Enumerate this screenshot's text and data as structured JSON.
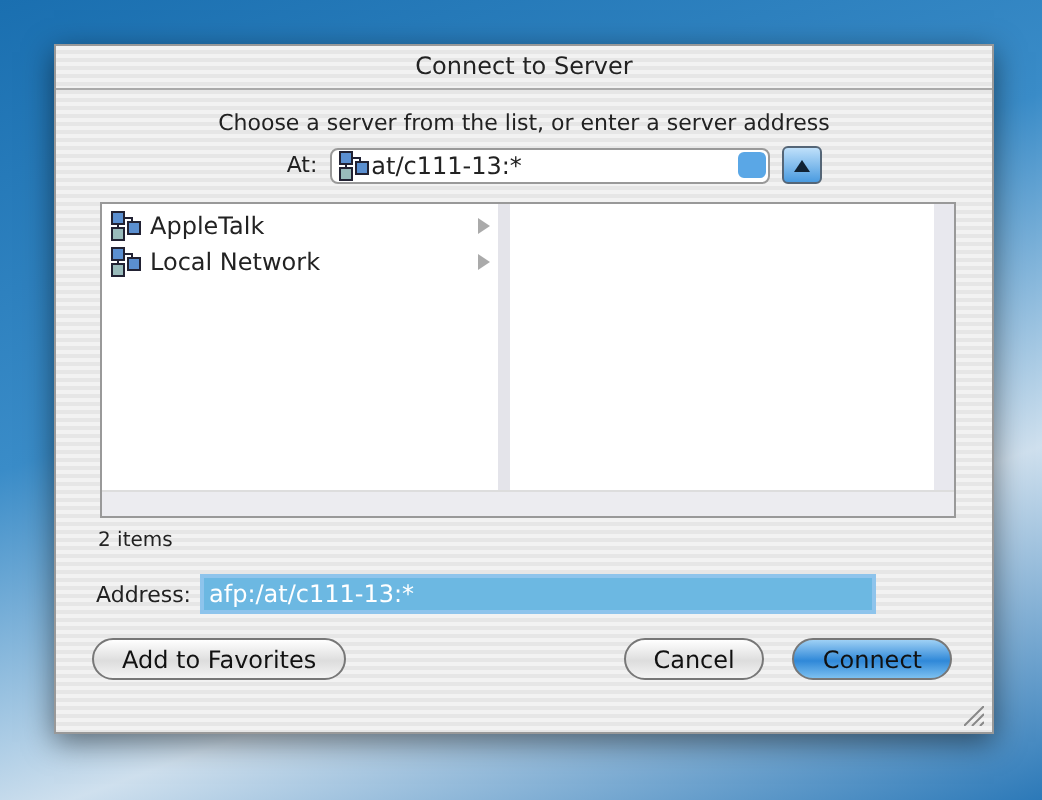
{
  "window": {
    "title": "Connect to Server"
  },
  "prompt": "Choose a server from the list, or enter a server address",
  "location": {
    "label": "At:",
    "value": "at/c111-13:*"
  },
  "browser": {
    "items": [
      {
        "label": "AppleTalk"
      },
      {
        "label": "Local Network"
      }
    ]
  },
  "item_count": "2 items",
  "address": {
    "label": "Address:",
    "value": "afp:/at/c111-13:*"
  },
  "buttons": [
    {
      "label": "Add to Favorites",
      "kind": "normal"
    },
    {
      "label": "Cancel",
      "kind": "normal"
    },
    {
      "label": "Connect",
      "kind": "default"
    }
  ]
}
